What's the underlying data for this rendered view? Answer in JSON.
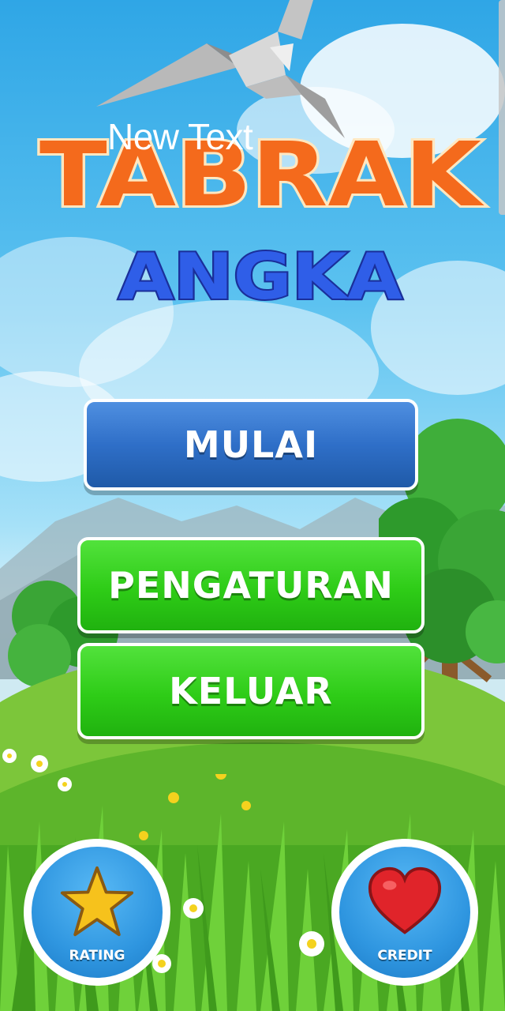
{
  "title": {
    "line1": "TABRAK",
    "line2": "ANGKA"
  },
  "placeholder_label": "New Text",
  "menu": {
    "start_label": "MULAI",
    "settings_label": "PENGATURAN",
    "exit_label": "KELUAR"
  },
  "footer": {
    "rating_label": "RATING",
    "credit_label": "CREDIT"
  },
  "icons": {
    "rating": "star-icon",
    "credit": "heart-icon"
  },
  "colors": {
    "title_primary": "#f46a1c",
    "title_secondary": "#2f5ee8",
    "button_blue": "#2f6fc8",
    "button_green": "#2ecc17",
    "circle_blue": "#2f96e0",
    "star_yellow": "#f6c21c",
    "heart_red": "#e0242a"
  }
}
